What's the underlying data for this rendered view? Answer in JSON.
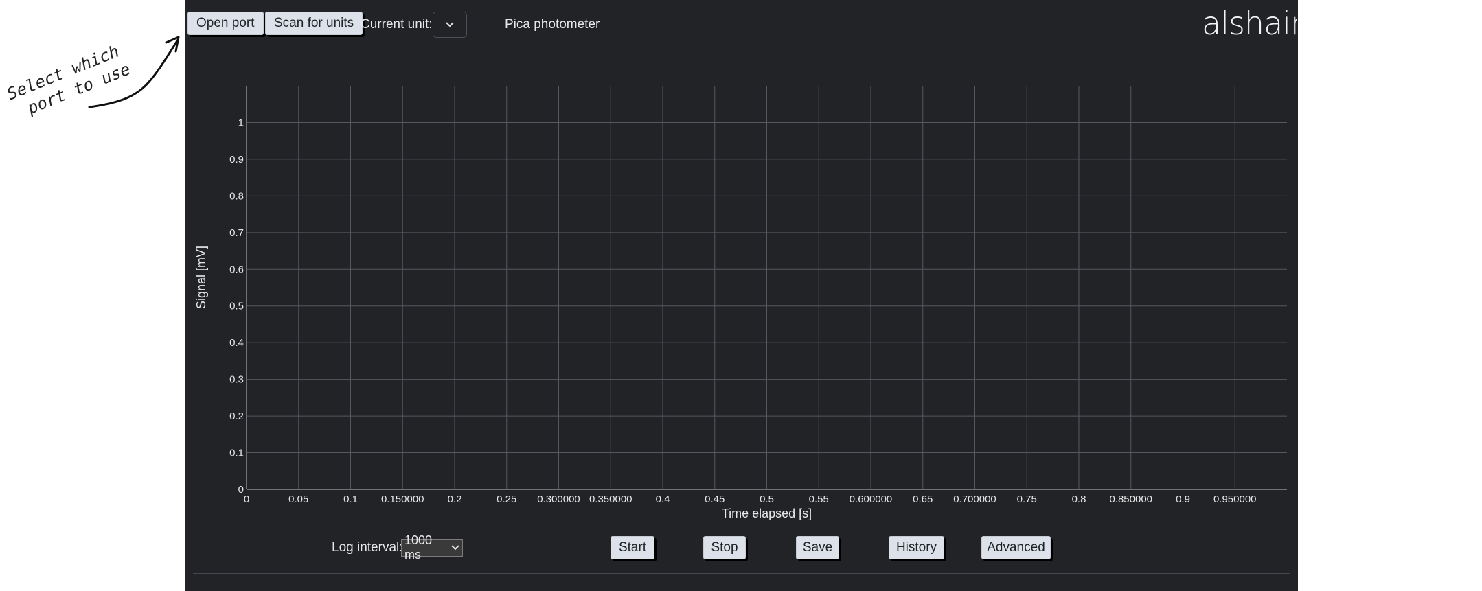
{
  "annotation": {
    "line1": "Select which",
    "line2": "port to use"
  },
  "toolbar": {
    "open_port_label": "Open port",
    "scan_label": "Scan for units",
    "current_unit_label": "Current unit:",
    "current_unit_value": "",
    "device_name": "Pica photometer"
  },
  "brand": {
    "logo_text": "alshain"
  },
  "chart_data": {
    "type": "line",
    "title": "",
    "xlabel": "Time elapsed [s]",
    "ylabel": "Signal [mV]",
    "xlim": [
      0,
      1
    ],
    "ylim": [
      0,
      1.1
    ],
    "x_ticks": [
      {
        "v": 0,
        "label": "0"
      },
      {
        "v": 0.05,
        "label": "0.05"
      },
      {
        "v": 0.1,
        "label": "0.1"
      },
      {
        "v": 0.15,
        "label": "0.150000"
      },
      {
        "v": 0.2,
        "label": "0.2"
      },
      {
        "v": 0.25,
        "label": "0.25"
      },
      {
        "v": 0.3,
        "label": "0.300000"
      },
      {
        "v": 0.35,
        "label": "0.350000"
      },
      {
        "v": 0.4,
        "label": "0.4"
      },
      {
        "v": 0.45,
        "label": "0.45"
      },
      {
        "v": 0.5,
        "label": "0.5"
      },
      {
        "v": 0.55,
        "label": "0.55"
      },
      {
        "v": 0.6,
        "label": "0.600000"
      },
      {
        "v": 0.65,
        "label": "0.65"
      },
      {
        "v": 0.7,
        "label": "0.700000"
      },
      {
        "v": 0.75,
        "label": "0.75"
      },
      {
        "v": 0.8,
        "label": "0.8"
      },
      {
        "v": 0.85,
        "label": "0.850000"
      },
      {
        "v": 0.9,
        "label": "0.9"
      },
      {
        "v": 0.95,
        "label": "0.950000"
      }
    ],
    "y_ticks": [
      {
        "v": 0,
        "label": "0"
      },
      {
        "v": 0.1,
        "label": "0.1"
      },
      {
        "v": 0.2,
        "label": "0.2"
      },
      {
        "v": 0.3,
        "label": "0.3"
      },
      {
        "v": 0.4,
        "label": "0.4"
      },
      {
        "v": 0.5,
        "label": "0.5"
      },
      {
        "v": 0.6,
        "label": "0.6"
      },
      {
        "v": 0.7,
        "label": "0.7"
      },
      {
        "v": 0.8,
        "label": "0.8"
      },
      {
        "v": 0.9,
        "label": "0.9"
      },
      {
        "v": 1,
        "label": "1"
      }
    ],
    "series": [],
    "grid": true,
    "colors": {
      "grid": "#55585e",
      "axis": "#bfc2c7",
      "text": "#e8e8e8"
    }
  },
  "controls": {
    "log_interval_label": "Log interval:",
    "log_interval_value": "1000 ms",
    "start_label": "Start",
    "stop_label": "Stop",
    "save_label": "Save",
    "history_label": "History",
    "advanced_label": "Advanced"
  },
  "colors": {
    "app_bg": "#212327",
    "button_bg": "#dde2ea",
    "text": "#e8e8e8"
  }
}
